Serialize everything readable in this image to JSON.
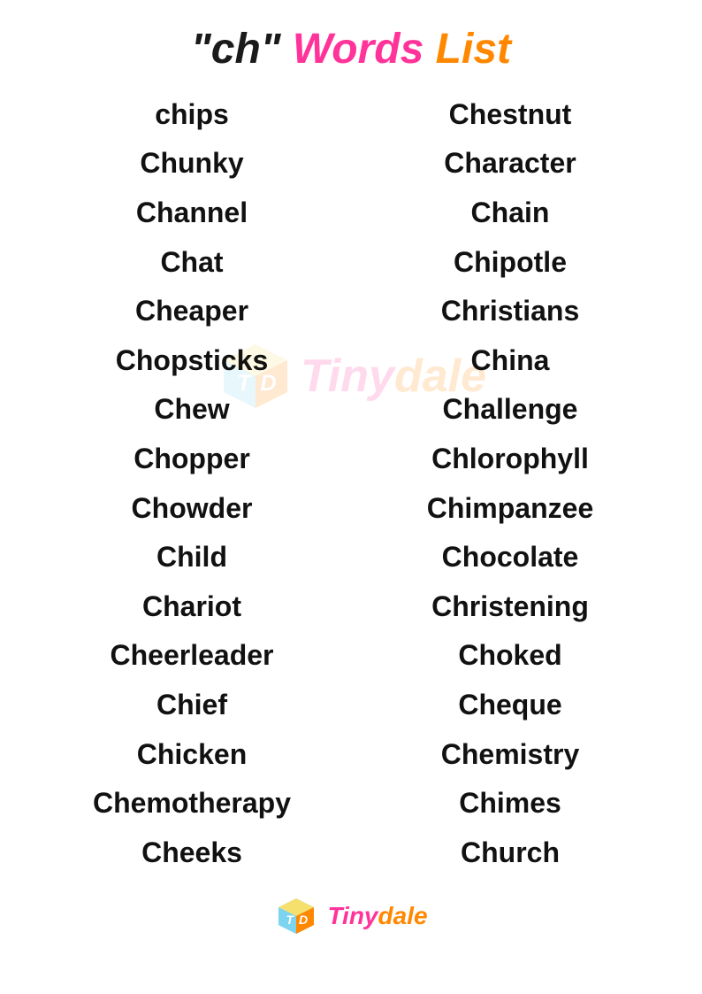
{
  "title": {
    "ch_part": "\"ch\"",
    "words_part": "Words",
    "list_part": "List"
  },
  "left_column": [
    "chips",
    "Chunky",
    "Channel",
    "Chat",
    "Cheaper",
    "Chopsticks",
    "Chew",
    "Chopper",
    "Chowder",
    "Child",
    "Chariot",
    "Cheerleader",
    "Chief",
    "Chicken",
    "Chemotherapy",
    "Cheeks"
  ],
  "right_column": [
    "Chestnut",
    "Character",
    "Chain",
    "Chipotle",
    "Christians",
    "China",
    "Challenge",
    "Chlorophyll",
    "Chimpanzee",
    "Chocolate",
    "Christening",
    "Choked",
    "Cheque",
    "Chemistry",
    "Chimes",
    "Church"
  ],
  "footer": {
    "brand_tiny": "Tiny",
    "brand_dale": "dale",
    "brand_full": "Tinydale"
  }
}
